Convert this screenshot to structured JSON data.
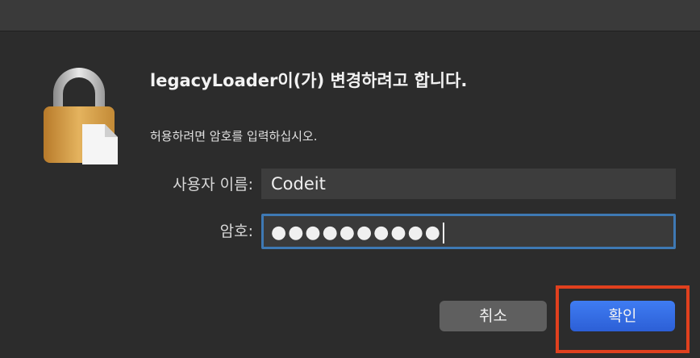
{
  "dialog": {
    "title": "legacyLoader이(가) 변경하려고 합니다.",
    "subtitle": "허용하려면 암호를 입력하십시오.",
    "username_label": "사용자 이름:",
    "username_value": "Codeit",
    "password_label": "암호:",
    "password_masked": "●●●●●●●●●●",
    "cancel_label": "취소",
    "ok_label": "확인"
  },
  "colors": {
    "accent": "#2f66e0",
    "focus_ring": "#3e79b4",
    "highlight": "#e0401e",
    "lock_body": "#d9a04a"
  },
  "icons": [
    "lock-icon"
  ]
}
